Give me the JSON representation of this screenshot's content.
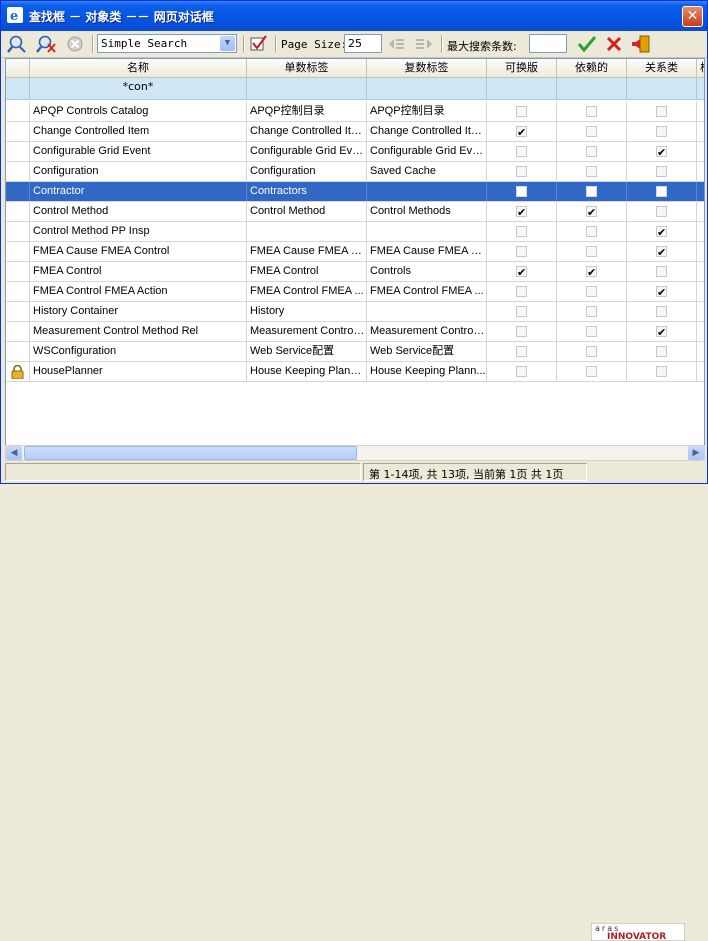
{
  "window": {
    "title": "查找框 － 对象类 －－ 网页对话框"
  },
  "toolbar": {
    "search_mode": "Simple Search",
    "page_size_label": "Page Size:",
    "page_size_value": "25",
    "max_results_label": "最大搜索条数:",
    "max_results_value": ""
  },
  "grid": {
    "columns": [
      "名称",
      "单数标签",
      "复数标签",
      "可换版",
      "依赖的",
      "关系类",
      "核"
    ],
    "filter": {
      "name": "*con*"
    },
    "rows": [
      {
        "name": "APQP Controls Catalog",
        "singular": "APQP控制目录",
        "plural": "APQP控制目录",
        "versionable": false,
        "dependent": false,
        "relationship": false
      },
      {
        "name": "Change Controlled Item",
        "singular": "Change Controlled Item",
        "plural": "Change Controlled Item",
        "versionable": true,
        "dependent": false,
        "relationship": false
      },
      {
        "name": "Configurable Grid Event",
        "singular": "Configurable Grid Event",
        "plural": "Configurable Grid Eve...",
        "versionable": false,
        "dependent": false,
        "relationship": true
      },
      {
        "name": "Configuration",
        "singular": "Configuration",
        "plural": "Saved Cache",
        "versionable": false,
        "dependent": false,
        "relationship": false
      },
      {
        "name": "Contractor",
        "singular": "Contractors",
        "plural": "",
        "versionable": false,
        "dependent": false,
        "relationship": false,
        "selected": true
      },
      {
        "name": "Control Method",
        "singular": "Control Method",
        "plural": "Control Methods",
        "versionable": true,
        "dependent": true,
        "relationship": false
      },
      {
        "name": "Control Method PP Insp",
        "singular": "",
        "plural": "",
        "versionable": false,
        "dependent": false,
        "relationship": true
      },
      {
        "name": "FMEA Cause FMEA Control",
        "singular": "FMEA Cause FMEA C...",
        "plural": "FMEA Cause FMEA C...",
        "versionable": false,
        "dependent": false,
        "relationship": true
      },
      {
        "name": "FMEA Control",
        "singular": "FMEA Control",
        "plural": "Controls",
        "versionable": true,
        "dependent": true,
        "relationship": false
      },
      {
        "name": "FMEA Control FMEA Action",
        "singular": "FMEA Control FMEA ...",
        "plural": "FMEA Control FMEA ...",
        "versionable": false,
        "dependent": false,
        "relationship": true
      },
      {
        "name": "History Container",
        "singular": "History",
        "plural": "",
        "versionable": false,
        "dependent": false,
        "relationship": false
      },
      {
        "name": "Measurement Control Method Rel",
        "singular": "Measurement Control ...",
        "plural": "Measurement Control ...",
        "versionable": false,
        "dependent": false,
        "relationship": true
      },
      {
        "name": "WSConfiguration",
        "singular": "Web Service配置",
        "plural": "Web Service配置",
        "versionable": false,
        "dependent": false,
        "relationship": false
      },
      {
        "name": "HousePlanner",
        "singular": "House Keeping Planner",
        "plural": "House Keeping Plann...",
        "versionable": false,
        "dependent": false,
        "relationship": false,
        "locked": true
      }
    ]
  },
  "status": {
    "text": "第 1-14项, 共 13项, 当前第 1页 共 1页"
  },
  "logo": {
    "top": "aras",
    "bottom": "INNOVATOR"
  },
  "colors": {
    "selection": "#3168c6",
    "filter_row": "#cfe6f7",
    "title_bar": "#0554e3"
  }
}
